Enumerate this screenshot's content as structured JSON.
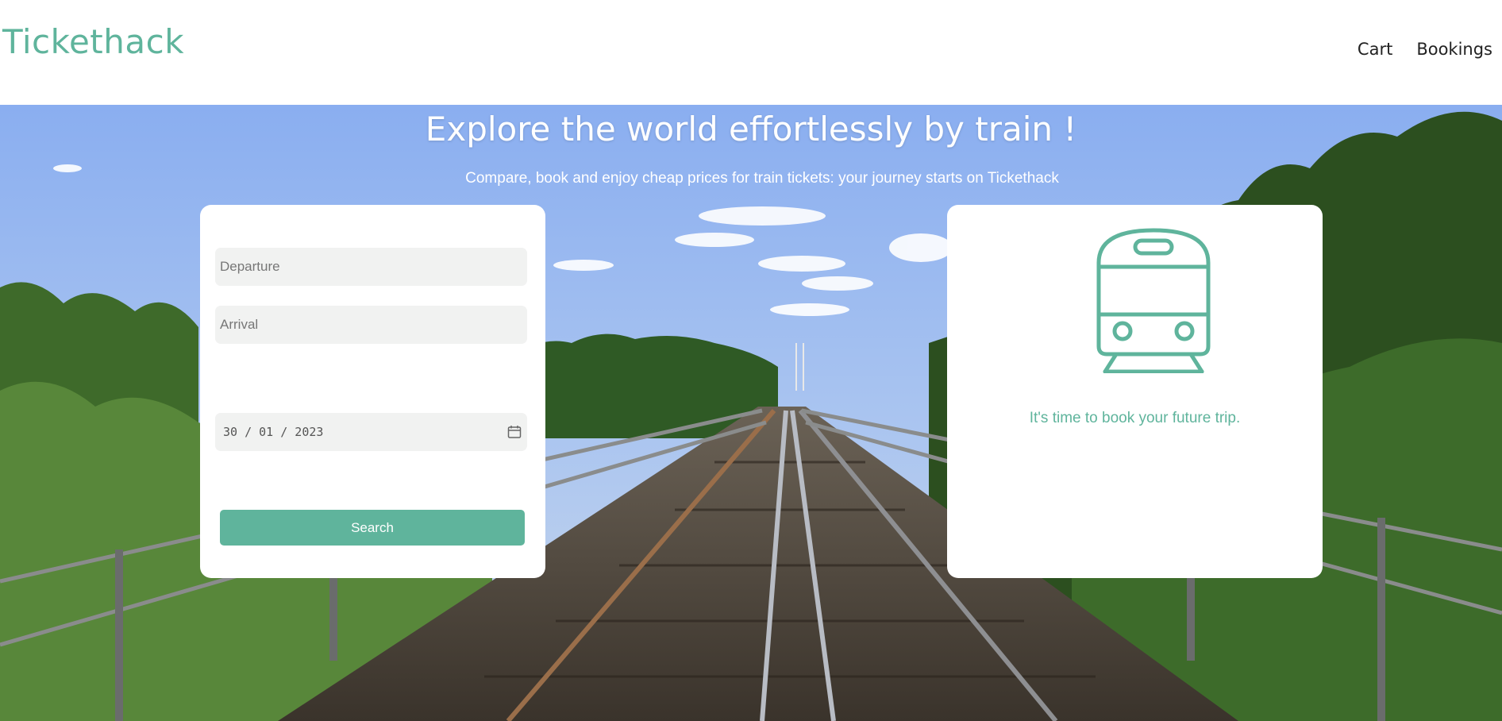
{
  "app": {
    "brand": "Tickethack",
    "nav": {
      "cart": "Cart",
      "bookings": "Bookings"
    }
  },
  "hero": {
    "title": "Explore the world effortlessly by train !",
    "subtitle": "Compare, book and enjoy cheap prices for train tickets: your journey starts on Tickethack"
  },
  "search_form": {
    "departure_placeholder": "Departure",
    "arrival_placeholder": "Arrival",
    "date_value": "30 / 01 / 2023",
    "search_label": "Search"
  },
  "info": {
    "message": "It's time to book your future trip.",
    "icon": "train-icon"
  },
  "colors": {
    "accent": "#5fb49c",
    "field_bg": "#f1f2f1"
  }
}
